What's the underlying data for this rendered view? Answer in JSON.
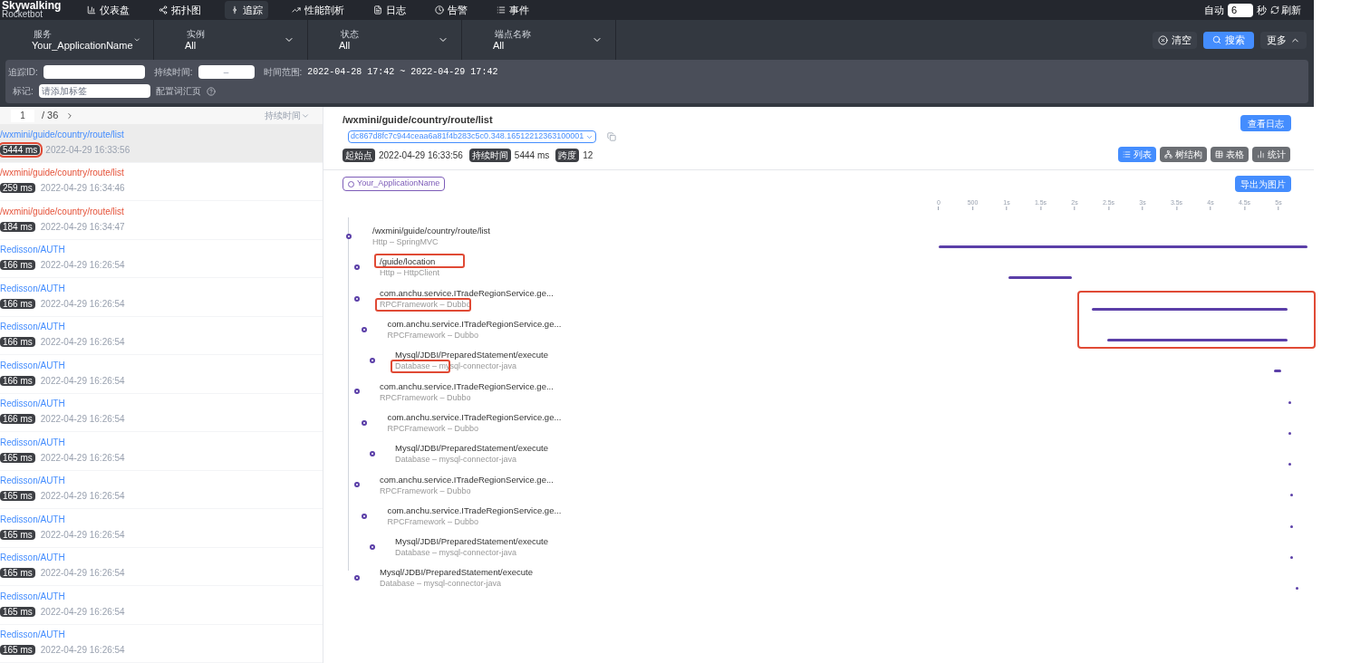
{
  "brand": {
    "name": "Skywalking",
    "sub": "Rocketbot"
  },
  "nav": [
    {
      "label": "仪表盘",
      "selected": false
    },
    {
      "label": "拓扑图",
      "selected": false
    },
    {
      "label": "追踪",
      "selected": true
    },
    {
      "label": "性能剖析",
      "selected": false
    },
    {
      "label": "日志",
      "selected": false
    },
    {
      "label": "告警",
      "selected": false
    },
    {
      "label": "事件",
      "selected": false
    }
  ],
  "auto_refresh": {
    "label": "自动",
    "value": "6",
    "unit": "秒",
    "refresh": "刷新"
  },
  "filters": [
    {
      "label": "服务",
      "value": "Your_ApplicationName"
    },
    {
      "label": "实例",
      "value": "All"
    },
    {
      "label": "状态",
      "value": "All"
    },
    {
      "label": "端点名称",
      "value": "All"
    }
  ],
  "actions": {
    "clear": "清空",
    "search": "搜索",
    "more": "更多"
  },
  "conditions": {
    "trace_id_label": "追踪ID:",
    "duration_label": "持续时间:",
    "duration_placeholder": "–",
    "time_range_label": "时间范围:",
    "time_range": "2022-04-28 17:42 ~ 2022-04-29 17:42",
    "tag_label": "标记:",
    "tag_placeholder": "请添加标签",
    "vocab_link": "配置词汇页"
  },
  "pager": {
    "page": "1",
    "total": "/ 36",
    "sort": "持续时间"
  },
  "traces": [
    {
      "name": "/wxmini/guide/country/route/list",
      "duration": "5444 ms",
      "time": "2022-04-29 16:33:56",
      "error": false,
      "selected": true,
      "marked": true
    },
    {
      "name": "/wxmini/guide/country/route/list",
      "duration": "259 ms",
      "time": "2022-04-29 16:34:46",
      "error": true,
      "selected": false,
      "marked": false
    },
    {
      "name": "/wxmini/guide/country/route/list",
      "duration": "184 ms",
      "time": "2022-04-29 16:34:47",
      "error": true,
      "selected": false,
      "marked": false
    },
    {
      "name": "Redisson/AUTH",
      "duration": "166 ms",
      "time": "2022-04-29 16:26:54",
      "error": false,
      "selected": false,
      "marked": false
    },
    {
      "name": "Redisson/AUTH",
      "duration": "166 ms",
      "time": "2022-04-29 16:26:54",
      "error": false,
      "selected": false,
      "marked": false
    },
    {
      "name": "Redisson/AUTH",
      "duration": "166 ms",
      "time": "2022-04-29 16:26:54",
      "error": false,
      "selected": false,
      "marked": false
    },
    {
      "name": "Redisson/AUTH",
      "duration": "166 ms",
      "time": "2022-04-29 16:26:54",
      "error": false,
      "selected": false,
      "marked": false
    },
    {
      "name": "Redisson/AUTH",
      "duration": "166 ms",
      "time": "2022-04-29 16:26:54",
      "error": false,
      "selected": false,
      "marked": false
    },
    {
      "name": "Redisson/AUTH",
      "duration": "165 ms",
      "time": "2022-04-29 16:26:54",
      "error": false,
      "selected": false,
      "marked": false
    },
    {
      "name": "Redisson/AUTH",
      "duration": "165 ms",
      "time": "2022-04-29 16:26:54",
      "error": false,
      "selected": false,
      "marked": false
    },
    {
      "name": "Redisson/AUTH",
      "duration": "165 ms",
      "time": "2022-04-29 16:26:54",
      "error": false,
      "selected": false,
      "marked": false
    },
    {
      "name": "Redisson/AUTH",
      "duration": "165 ms",
      "time": "2022-04-29 16:26:54",
      "error": false,
      "selected": false,
      "marked": false
    },
    {
      "name": "Redisson/AUTH",
      "duration": "165 ms",
      "time": "2022-04-29 16:26:54",
      "error": false,
      "selected": false,
      "marked": false
    },
    {
      "name": "Redisson/AUTH",
      "duration": "165 ms",
      "time": "2022-04-29 16:26:54",
      "error": false,
      "selected": false,
      "marked": false
    }
  ],
  "detail": {
    "title": "/wxmini/guide/country/route/list",
    "trace_id": "dc867d8fc7c944ceaa6a81f4b283c5c0.348.16512212363100001",
    "logs_button": "查看日志",
    "start_label": "起始点",
    "start": "2022-04-29 16:33:56",
    "duration_label": "持续时间",
    "duration": "5444 ms",
    "span_label": "跨度",
    "spans": "12",
    "views": [
      {
        "label": "列表",
        "selected": true
      },
      {
        "label": "树结构",
        "selected": false
      },
      {
        "label": "表格",
        "selected": false
      },
      {
        "label": "统计",
        "selected": false
      }
    ],
    "service": "Your_ApplicationName",
    "export_button": "导出为图片"
  },
  "axis_ticks": [
    "0",
    "500",
    "1s",
    "1.5s",
    "2s",
    "2.5s",
    "3s",
    "3.5s",
    "4s",
    "4.5s",
    "5s"
  ],
  "timeline_marked": true,
  "spans": [
    {
      "title": "/wxmini/guide/country/route/list",
      "sub": "Http – SpringMVC",
      "children": [
        {
          "title": "/guide/location",
          "sub": "Http – HttpClient",
          "title_marked": true
        },
        {
          "title": "com.anchu.service.ITradeRegionService.ge...",
          "sub": "RPCFramework – Dubbo",
          "sub_marked": true,
          "children": [
            {
              "title": "com.anchu.service.ITradeRegionService.ge...",
              "sub": "RPCFramework – Dubbo",
              "children": [
                {
                  "title": "Mysql/JDBI/PreparedStatement/execute",
                  "sub": "Database – mysql-connector-java",
                  "sub_marked": true
                }
              ]
            }
          ]
        },
        {
          "title": "com.anchu.service.ITradeRegionService.ge...",
          "sub": "RPCFramework – Dubbo",
          "children": [
            {
              "title": "com.anchu.service.ITradeRegionService.ge...",
              "sub": "RPCFramework – Dubbo",
              "children": [
                {
                  "title": "Mysql/JDBI/PreparedStatement/execute",
                  "sub": "Database – mysql-connector-java"
                }
              ]
            }
          ]
        },
        {
          "title": "com.anchu.service.ITradeRegionService.ge...",
          "sub": "RPCFramework – Dubbo",
          "children": [
            {
              "title": "com.anchu.service.ITradeRegionService.ge...",
              "sub": "RPCFramework – Dubbo",
              "children": [
                {
                  "title": "Mysql/JDBI/PreparedStatement/execute",
                  "sub": "Database – mysql-connector-java"
                }
              ]
            }
          ]
        },
        {
          "title": "Mysql/JDBI/PreparedStatement/execute",
          "sub": "Database – mysql-connector-java"
        }
      ]
    }
  ]
}
